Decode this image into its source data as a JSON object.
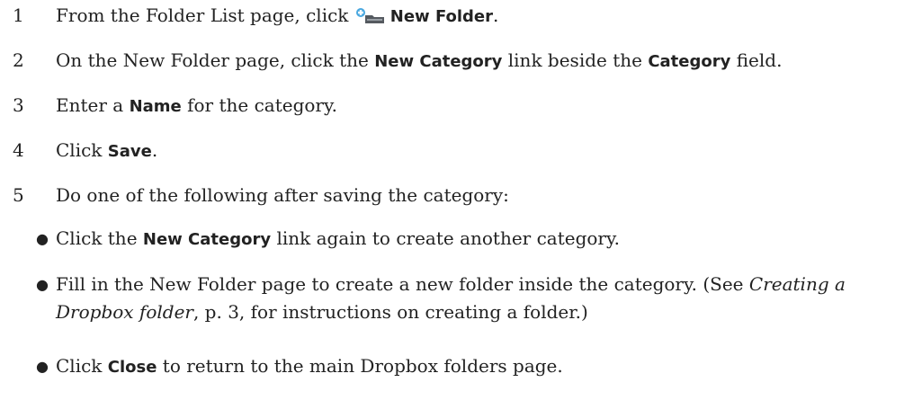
{
  "steps": [
    {
      "num": "1",
      "pre": "From the Folder List page, click ",
      "icon": "new-folder-icon",
      "bold": "New Folder",
      "post": "."
    },
    {
      "num": "2",
      "pre": "On the New Folder page, click the ",
      "bold1": "New Category",
      "mid": " link beside the ",
      "bold2": "Category",
      "post": " field."
    },
    {
      "num": "3",
      "pre": "Enter a ",
      "bold": "Name",
      "post": " for the category."
    },
    {
      "num": "4",
      "pre": "Click ",
      "bold": "Save",
      "post": "."
    },
    {
      "num": "5",
      "text": "Do one of the following after saving the category:"
    }
  ],
  "bullets": [
    {
      "pre": "Click the ",
      "bold": "New Category",
      "post": " link again to create another category."
    },
    {
      "pre": "Fill in the New Folder page to create a new folder inside the category. (See ",
      "italic": "Creating a Dropbox folder",
      "post": ", p. 3, for instructions on creating a folder.)"
    },
    {
      "pre": "Click ",
      "bold": "Close",
      "post": " to return to the main Dropbox folders page."
    }
  ]
}
